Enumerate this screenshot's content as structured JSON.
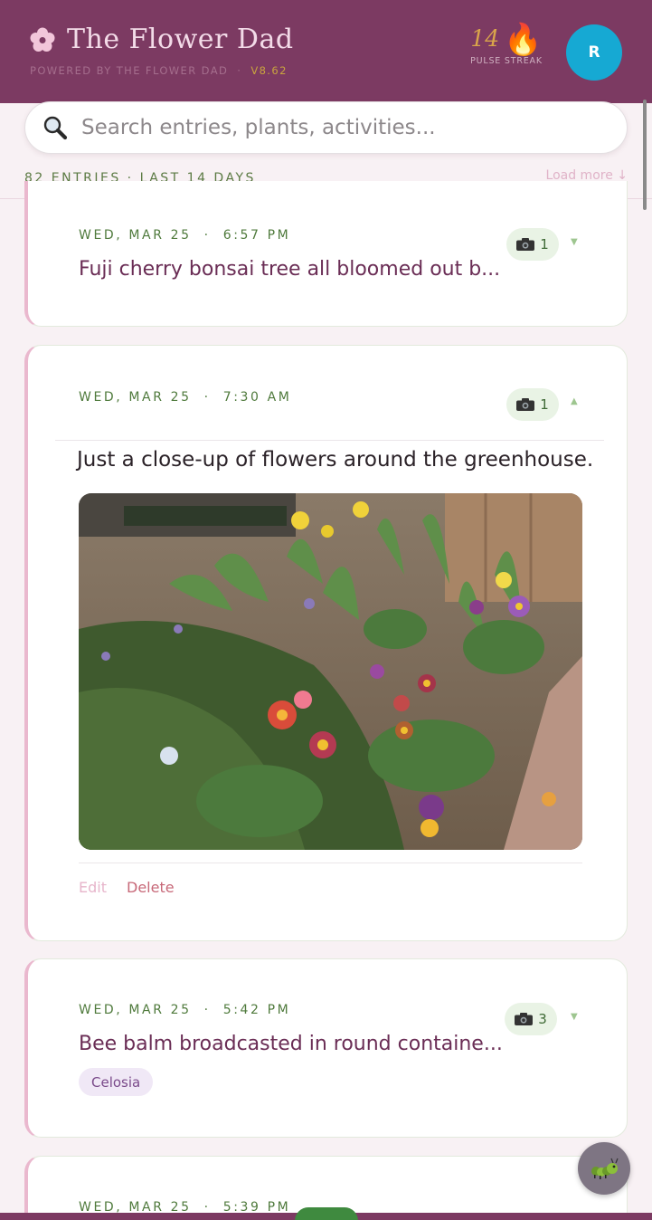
{
  "header": {
    "title": "The Flower Dad",
    "subtitle": "POWERED BY THE FLOWER DAD",
    "version": "V8.62",
    "streak_count": "14",
    "streak_label": "PULSE STREAK",
    "avatar_initial": "R",
    "icons": [
      "flower-icon",
      "fire-icon"
    ]
  },
  "search": {
    "placeholder": "Search entries, plants, activities..."
  },
  "summary": {
    "count_label": "82 ENTRIES · LAST 14 DAYS",
    "load_more": "Load more ↓"
  },
  "entries": [
    {
      "day": "WED, MAR 25",
      "time": "6:57 PM",
      "title": "Fuji cherry bonsai tree all bloomed out b...",
      "photos": "1",
      "expanded": false
    },
    {
      "day": "WED, MAR 25",
      "time": "7:30 AM",
      "text": "Just a close-up of flowers around the greenhouse.",
      "photos": "1",
      "expanded": true,
      "edit": "Edit",
      "delete": "Delete"
    },
    {
      "day": "WED, MAR 25",
      "time": "5:42 PM",
      "title": "Bee balm broadcasted in round containe...",
      "photos": "3",
      "tag": "Celosia",
      "expanded": false
    },
    {
      "day": "WED, MAR 25",
      "time": "5:39 PM"
    }
  ],
  "colors": {
    "header": "#7c3a62",
    "accent_green": "#4f7a3c",
    "avatar": "#16a9d3",
    "card_border_left": "#eab8ce"
  }
}
